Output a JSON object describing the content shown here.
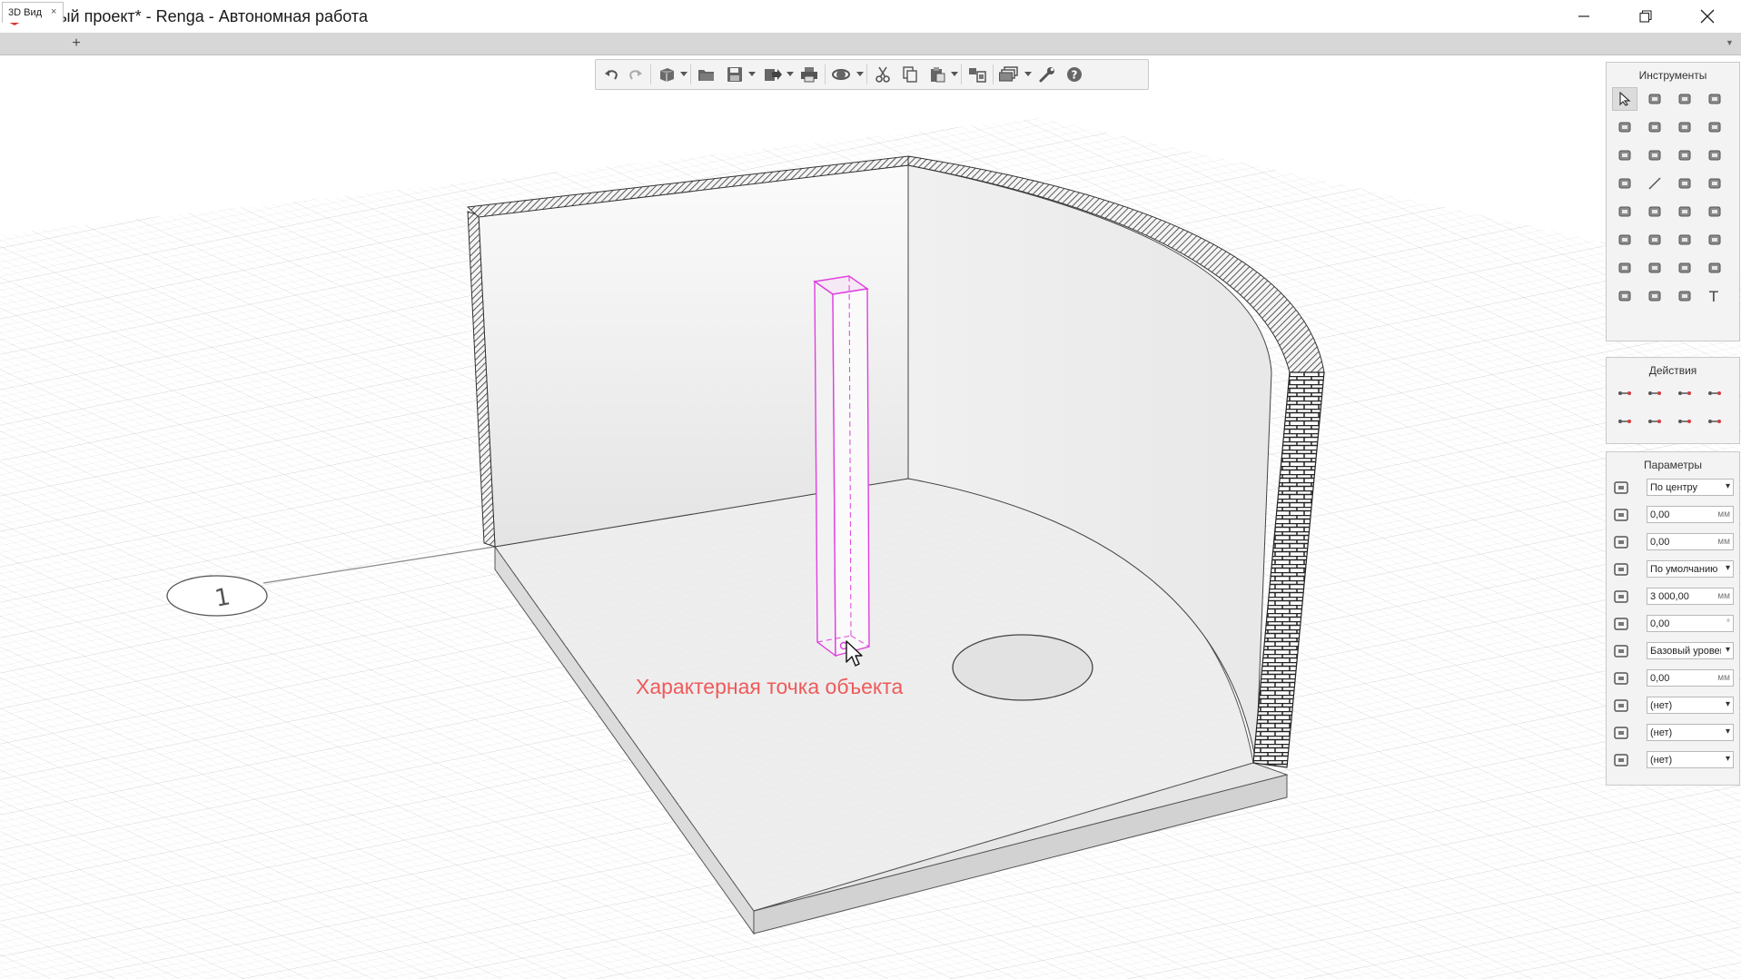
{
  "window": {
    "title": "Новый проект* - Renga - Автономная работа",
    "accent": "#e04040"
  },
  "tabs": [
    {
      "label": "3D Вид",
      "close": "×"
    }
  ],
  "tab_add": "+",
  "toolbar": {
    "buttons": [
      "undo-icon",
      "redo-icon",
      "view-cube-icon",
      "open-folder-icon",
      "save-icon",
      "export-icon",
      "print-icon",
      "orbit-icon",
      "cut-icon",
      "copy-icon",
      "paste-icon",
      "visibility-icon",
      "layers-icon",
      "settings-wrench-icon",
      "help-icon"
    ]
  },
  "panels": {
    "tools": {
      "title": "Инструменты"
    },
    "actions": {
      "title": "Действия"
    },
    "params": {
      "title": "Параметры",
      "rows": [
        {
          "icon": "placement-icon",
          "value": "По центру",
          "dropdown": true
        },
        {
          "icon": "offset-x-icon",
          "value": "0,00",
          "unit": "мм"
        },
        {
          "icon": "offset-y-icon",
          "value": "0,00",
          "unit": "мм"
        },
        {
          "icon": "style-icon",
          "value": "По умолчанию",
          "dropdown": true
        },
        {
          "icon": "height-icon",
          "value": "3 000,00",
          "unit": "мм"
        },
        {
          "icon": "rotation-icon",
          "value": "0,00",
          "unit": "°"
        },
        {
          "icon": "level-icon",
          "value": "Базовый уровень",
          "dropdown": true
        },
        {
          "icon": "elevation-icon",
          "value": "0,00",
          "unit": "мм"
        },
        {
          "icon": "material-icon",
          "value": "(нет)",
          "dropdown": true
        },
        {
          "icon": "hatch-icon",
          "value": "(нет)",
          "dropdown": true
        },
        {
          "icon": "label-icon",
          "value": "(нет)",
          "dropdown": true
        }
      ]
    }
  },
  "viewport": {
    "annotation": "Характерная точка объекта",
    "axis_label": "1",
    "selection_color": "#e040e0"
  }
}
